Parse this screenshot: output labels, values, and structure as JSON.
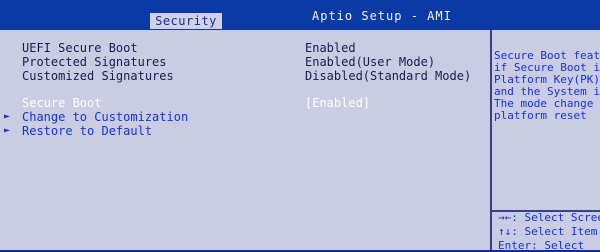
{
  "header": {
    "title": "Aptio Setup - AMI",
    "tab": "Security"
  },
  "settings": {
    "uefi_secure_boot": {
      "label": "UEFI Secure Boot",
      "value": "Enabled"
    },
    "protected_signatures": {
      "label": "Protected Signatures",
      "value": "Enabled(User Mode)"
    },
    "customized_signatures": {
      "label": "Customized Signatures",
      "value": "Disabled(Standard Mode)"
    },
    "secure_boot": {
      "label": "Secure Boot",
      "value": "[Enabled]"
    },
    "change_to_customization": {
      "label": "Change to Customization"
    },
    "restore_to_default": {
      "label": "Restore to Default"
    }
  },
  "help": {
    "lines": [
      "Secure Boot featu",
      "if Secure Boot is",
      "Platform Key(PK)",
      "and the System is",
      "The mode change r",
      "platform reset"
    ],
    "keys": [
      "→←: Select Scree",
      "↑↓: Select Item",
      "Enter: Select"
    ]
  },
  "colors": {
    "header_bg": "#0b3aa5",
    "panel_bg": "#c9cce2",
    "text_dark": "#1c1c4d",
    "link_blue": "#1434d6",
    "highlight": "#ffffff"
  },
  "icons": {
    "submenu_arrow": "►"
  }
}
